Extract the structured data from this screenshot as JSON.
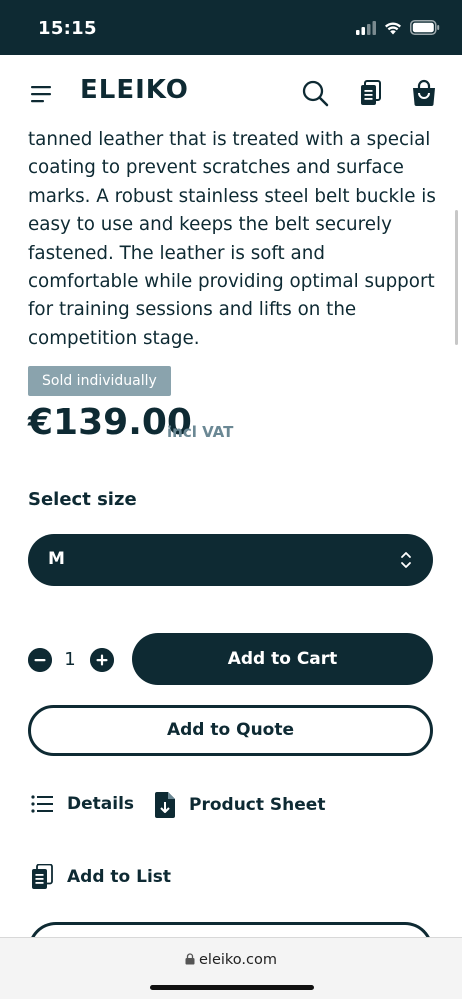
{
  "status_bar": {
    "time": "15:15"
  },
  "header": {
    "logo": "ELEIKO"
  },
  "product": {
    "description": "tanned leather that is treated with a special coating to prevent scratches and surface marks. A robust stainless steel belt buckle is easy to use and keeps the belt securely fastened. The leather is soft and comfortable while providing optimal support for training sessions and lifts on the competition stage.",
    "badge": "Sold individually",
    "price": "€139.00",
    "vat_label": "incl VAT"
  },
  "size": {
    "label": "Select size",
    "selected": "M"
  },
  "quantity": {
    "value": "1"
  },
  "actions": {
    "add_to_cart": "Add to Cart",
    "add_to_quote": "Add to Quote",
    "details": "Details",
    "product_sheet": "Product Sheet",
    "add_to_list": "Add to List"
  },
  "browser": {
    "url": "eleiko.com"
  },
  "colors": {
    "primary": "#0e2a33",
    "badge": "#8aa3ad",
    "vat": "#6b8894"
  }
}
